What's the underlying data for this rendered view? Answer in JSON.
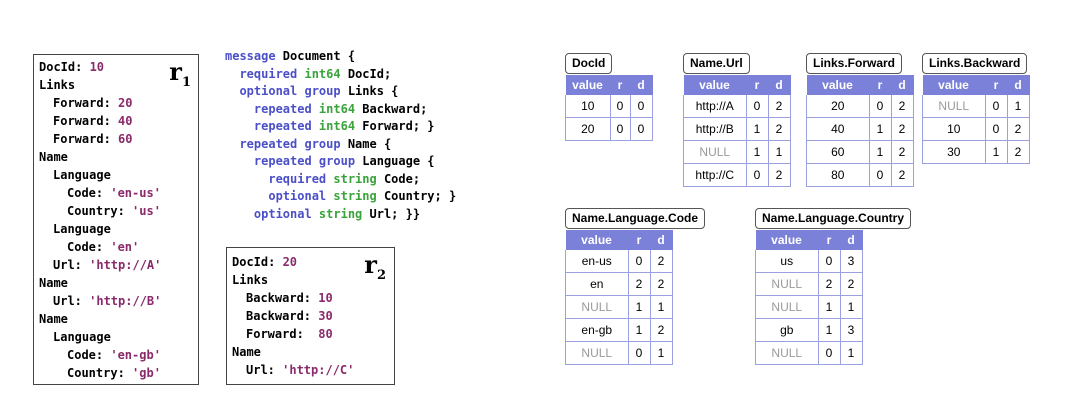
{
  "records": {
    "r1": {
      "title": "r",
      "subscript": "1",
      "lines": [
        {
          "key": "DocId:",
          "val": " 10",
          "indent": 0
        },
        {
          "key": "Links",
          "val": "",
          "indent": 0
        },
        {
          "key": "Forward:",
          "val": " 20",
          "indent": 1
        },
        {
          "key": "Forward:",
          "val": " 40",
          "indent": 1
        },
        {
          "key": "Forward:",
          "val": " 60",
          "indent": 1
        },
        {
          "key": "Name",
          "val": "",
          "indent": 0
        },
        {
          "key": "Language",
          "val": "",
          "indent": 1
        },
        {
          "key": "Code:",
          "val": " 'en-us'",
          "indent": 2
        },
        {
          "key": "Country:",
          "val": " 'us'",
          "indent": 2
        },
        {
          "key": "Language",
          "val": "",
          "indent": 1
        },
        {
          "key": "Code:",
          "val": " 'en'",
          "indent": 2
        },
        {
          "key": "Url:",
          "val": " 'http://A'",
          "indent": 1
        },
        {
          "key": "Name",
          "val": "",
          "indent": 0
        },
        {
          "key": "Url:",
          "val": " 'http://B'",
          "indent": 1
        },
        {
          "key": "Name",
          "val": "",
          "indent": 0
        },
        {
          "key": "Language",
          "val": "",
          "indent": 1
        },
        {
          "key": "Code:",
          "val": " 'en-gb'",
          "indent": 2
        },
        {
          "key": "Country:",
          "val": " 'gb'",
          "indent": 2
        }
      ]
    },
    "r2": {
      "title": "r",
      "subscript": "2",
      "lines": [
        {
          "key": "DocId:",
          "val": " 20",
          "indent": 0
        },
        {
          "key": "Links",
          "val": "",
          "indent": 0
        },
        {
          "key": "Backward:",
          "val": " 10",
          "indent": 1
        },
        {
          "key": "Backward:",
          "val": " 30",
          "indent": 1
        },
        {
          "key": "Forward:",
          "val": "  80",
          "indent": 1
        },
        {
          "key": "Name",
          "val": "",
          "indent": 0
        },
        {
          "key": "Url:",
          "val": " 'http://C'",
          "indent": 1
        }
      ]
    }
  },
  "schema": {
    "lines": [
      [
        {
          "t": "message ",
          "c": "kw"
        },
        {
          "t": "Document {",
          "c": "txt"
        }
      ],
      [
        {
          "t": "  required ",
          "c": "kw"
        },
        {
          "t": "int64 ",
          "c": "type"
        },
        {
          "t": "DocId;",
          "c": "txt"
        }
      ],
      [
        {
          "t": "  optional group ",
          "c": "kw"
        },
        {
          "t": "Links {",
          "c": "txt"
        }
      ],
      [
        {
          "t": "    repeated ",
          "c": "kw"
        },
        {
          "t": "int64 ",
          "c": "type"
        },
        {
          "t": "Backward;",
          "c": "txt"
        }
      ],
      [
        {
          "t": "    repeated ",
          "c": "kw"
        },
        {
          "t": "int64 ",
          "c": "type"
        },
        {
          "t": "Forward; }",
          "c": "txt"
        }
      ],
      [
        {
          "t": "  repeated group ",
          "c": "kw"
        },
        {
          "t": "Name {",
          "c": "txt"
        }
      ],
      [
        {
          "t": "    repeated group ",
          "c": "kw"
        },
        {
          "t": "Language {",
          "c": "txt"
        }
      ],
      [
        {
          "t": "      required ",
          "c": "kw"
        },
        {
          "t": "string ",
          "c": "type"
        },
        {
          "t": "Code;",
          "c": "txt"
        }
      ],
      [
        {
          "t": "      optional ",
          "c": "kw"
        },
        {
          "t": "string ",
          "c": "type"
        },
        {
          "t": "Country; }",
          "c": "txt"
        }
      ],
      [
        {
          "t": "    optional ",
          "c": "kw"
        },
        {
          "t": "string ",
          "c": "type"
        },
        {
          "t": "Url; }}",
          "c": "txt"
        }
      ]
    ]
  },
  "columns": [
    {
      "name": "DocId",
      "rows": [
        [
          "10",
          "0",
          "0"
        ],
        [
          "20",
          "0",
          "0"
        ]
      ]
    },
    {
      "name": "Name.Url",
      "rows": [
        [
          "http://A",
          "0",
          "2"
        ],
        [
          "http://B",
          "1",
          "2"
        ],
        [
          "NULL",
          "1",
          "1"
        ],
        [
          "http://C",
          "0",
          "2"
        ]
      ]
    },
    {
      "name": "Links.Forward",
      "rows": [
        [
          "20",
          "0",
          "2"
        ],
        [
          "40",
          "1",
          "2"
        ],
        [
          "60",
          "1",
          "2"
        ],
        [
          "80",
          "0",
          "2"
        ]
      ]
    },
    {
      "name": "Links.Backward",
      "rows": [
        [
          "NULL",
          "0",
          "1"
        ],
        [
          "10",
          "0",
          "2"
        ],
        [
          "30",
          "1",
          "2"
        ]
      ]
    },
    {
      "name": "Name.Language.Code",
      "rows": [
        [
          "en-us",
          "0",
          "2"
        ],
        [
          "en",
          "2",
          "2"
        ],
        [
          "NULL",
          "1",
          "1"
        ],
        [
          "en-gb",
          "1",
          "2"
        ],
        [
          "NULL",
          "0",
          "1"
        ]
      ]
    },
    {
      "name": "Name.Language.Country",
      "rows": [
        [
          "us",
          "0",
          "3"
        ],
        [
          "NULL",
          "2",
          "2"
        ],
        [
          "NULL",
          "1",
          "1"
        ],
        [
          "gb",
          "1",
          "3"
        ],
        [
          "NULL",
          "0",
          "1"
        ]
      ]
    }
  ],
  "column_headers": {
    "value": "value",
    "r": "r",
    "d": "d"
  },
  "colors": {
    "keyword": "#4b4fc7",
    "type": "#3aa33a",
    "value": "#8a2a6a",
    "header_bg": "#7b81d8",
    "null_text": "#9a9a9a"
  }
}
